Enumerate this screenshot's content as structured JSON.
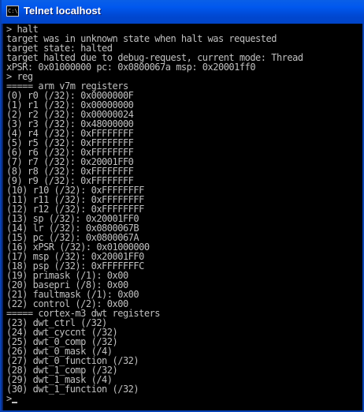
{
  "window": {
    "title": "Telnet localhost",
    "icon": "console-icon",
    "icon_text": "C:\\"
  },
  "console": {
    "lines": [
      "> halt",
      "target was in unknown state when halt was requested",
      "target state: halted",
      "target halted due to debug-request, current mode: Thread",
      "xPSR: 0x01000000 pc: 0x0800067a msp: 0x20001ff0",
      "> reg",
      "===== arm v7m registers",
      "(0) r0 (/32): 0x0000000F",
      "(1) r1 (/32): 0x00000000",
      "(2) r2 (/32): 0x00000024",
      "(3) r3 (/32): 0x48000000",
      "(4) r4 (/32): 0xFFFFFFFF",
      "(5) r5 (/32): 0xFFFFFFFF",
      "(6) r6 (/32): 0xFFFFFFFF",
      "(7) r7 (/32): 0x20001FF0",
      "(8) r8 (/32): 0xFFFFFFFF",
      "(9) r9 (/32): 0xFFFFFFFF",
      "(10) r10 (/32): 0xFFFFFFFF",
      "(11) r11 (/32): 0xFFFFFFFF",
      "(12) r12 (/32): 0xFFFFFFFF",
      "(13) sp (/32): 0x20001FF0",
      "(14) lr (/32): 0x0800067B",
      "(15) pc (/32): 0x0800067A",
      "(16) xPSR (/32): 0x01000000",
      "(17) msp (/32): 0x20001FF0",
      "(18) psp (/32): 0xFFFFFFFC",
      "(19) primask (/1): 0x00",
      "(20) basepri (/8): 0x00",
      "(21) faultmask (/1): 0x00",
      "(22) control (/2): 0x00",
      "===== cortex-m3 dwt registers",
      "(23) dwt_ctrl (/32)",
      "(24) dwt_cyccnt (/32)",
      "(25) dwt_0_comp (/32)",
      "(26) dwt_0_mask (/4)",
      "(27) dwt_0_function (/32)",
      "(28) dwt_1_comp (/32)",
      "(29) dwt_1_mask (/4)",
      "(30) dwt_1_function (/32)"
    ],
    "prompt": ">"
  }
}
